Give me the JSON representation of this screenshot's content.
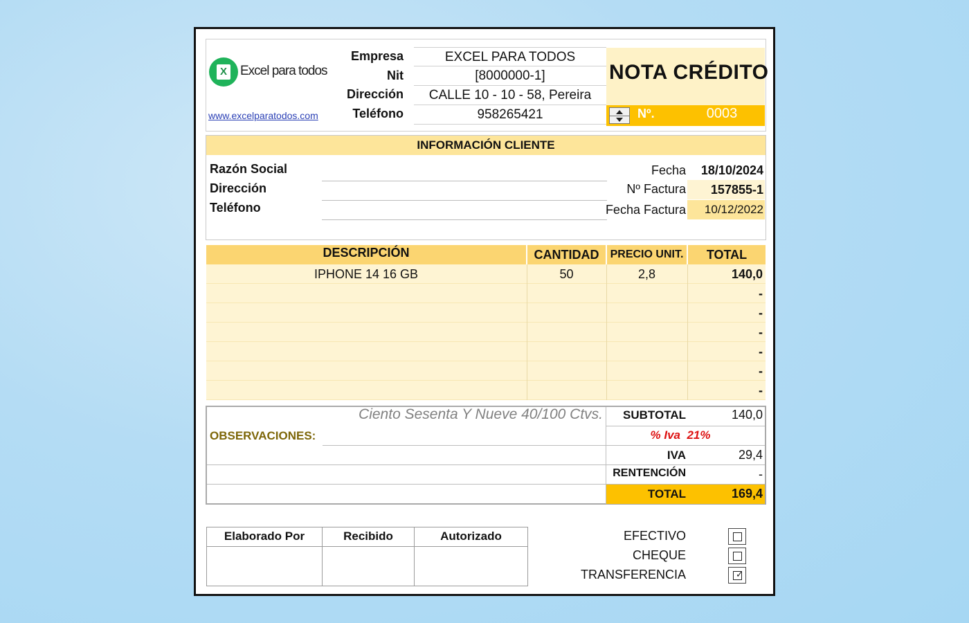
{
  "empresa": {
    "logo_text": "Excel para todos",
    "logo_glyph": "X",
    "website": "www.excelparatodos.com",
    "labels": {
      "empresa": "Empresa",
      "nit": "Nit",
      "direccion": "Dirección",
      "telefono": "Teléfono"
    },
    "values": {
      "empresa": "EXCEL PARA TODOS",
      "nit": "[8000000-1]",
      "direccion": "CALLE 10 - 10 - 58, Pereira",
      "telefono": "958265421"
    }
  },
  "documento": {
    "title": "NOTA CRÉDITO",
    "numero_label": "Nº.",
    "numero": "0003"
  },
  "cliente": {
    "section_title": "INFORMACIÓN CLIENTE",
    "labels": {
      "razon_social": "Razón Social",
      "direccion": "Dirección",
      "telefono": "Teléfono"
    },
    "values": {
      "razon_social": "",
      "direccion": "",
      "telefono": ""
    },
    "fecha_label": "Fecha",
    "fecha": "18/10/2024",
    "factura_label": "Nº Factura",
    "factura": "157855-1",
    "fecha_factura_label": "Fecha Factura",
    "fecha_factura": "10/12/2022"
  },
  "items": {
    "headers": {
      "descripcion": "DESCRIPCIÓN",
      "cantidad": "CANTIDAD",
      "precio": "PRECIO UNIT.",
      "total": "TOTAL"
    },
    "rows": [
      {
        "descripcion": "IPHONE 14 16 GB",
        "cantidad": "50",
        "precio": "2,8",
        "total": "140,0"
      },
      {
        "descripcion": "",
        "cantidad": "",
        "precio": "",
        "total": "-"
      },
      {
        "descripcion": "",
        "cantidad": "",
        "precio": "",
        "total": "-"
      },
      {
        "descripcion": "",
        "cantidad": "",
        "precio": "",
        "total": "-"
      },
      {
        "descripcion": "",
        "cantidad": "",
        "precio": "",
        "total": "-"
      },
      {
        "descripcion": "",
        "cantidad": "",
        "precio": "",
        "total": "-"
      },
      {
        "descripcion": "",
        "cantidad": "",
        "precio": "",
        "total": "-"
      }
    ]
  },
  "resumen": {
    "amount_in_words": "Ciento Sesenta Y Nueve  40/100 Ctvs.",
    "observaciones_label": "OBSERVACIONES:",
    "subtotal_label": "SUBTOTAL",
    "subtotal": "140,0",
    "iva_pct_label": "% Iva",
    "iva_pct": "21%",
    "iva_label": "IVA",
    "iva": "29,4",
    "retencion_label": "RENTENCIÓN",
    "retencion": "-",
    "total_label": "TOTAL",
    "total": "169,4"
  },
  "firmas": {
    "elaborado": "Elaborado Por",
    "recibido": "Recibido",
    "autorizado": "Autorizado"
  },
  "pago": {
    "efectivo": "EFECTIVO",
    "efectivo_checked": false,
    "cheque": "CHEQUE",
    "cheque_checked": false,
    "transferencia": "TRANSFERENCIA",
    "transferencia_checked": true,
    "check_glyph": "✓"
  },
  "colors": {
    "accent_yellow": "#fdc100",
    "header_yellow": "#fbd571",
    "row_cream": "#fef4d3",
    "brand_green": "#1fb35a",
    "iva_red": "#dd1111"
  }
}
